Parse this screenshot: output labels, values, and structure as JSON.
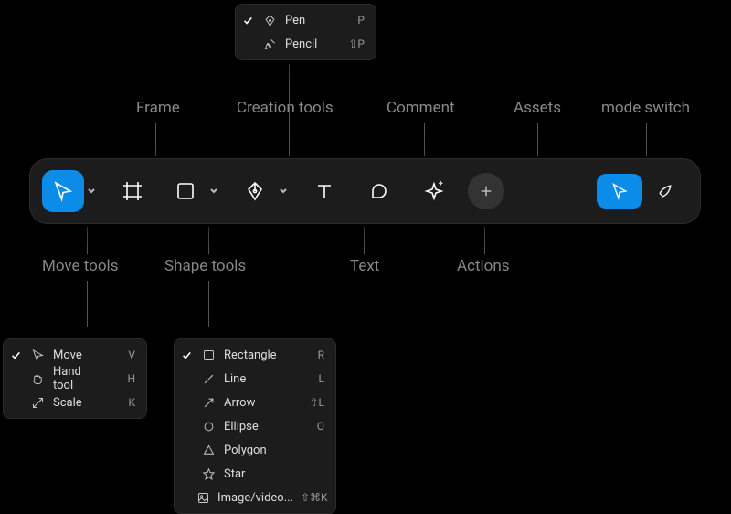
{
  "labels": {
    "frame": "Frame",
    "creation_tools": "Creation tools",
    "comment": "Comment",
    "assets": "Assets",
    "mode_switch": "mode switch",
    "move_tools": "Move tools",
    "shape_tools": "Shape tools",
    "text": "Text",
    "actions": "Actions"
  },
  "toolbar": {
    "move": {
      "name": "move-tool",
      "gap_after": 8,
      "has_chevron": true,
      "active": true
    },
    "frame": {
      "name": "frame-tool",
      "gap_after": 10
    },
    "shape": {
      "name": "shape-tool",
      "gap_after": 8,
      "has_chevron": true
    },
    "pen": {
      "name": "pen-tool",
      "gap_after": 8,
      "has_chevron": true
    },
    "text": {
      "name": "text-tool",
      "gap_after": 10
    },
    "comment": {
      "name": "comment-tool",
      "gap_after": 10
    },
    "actions": {
      "name": "actions-tool",
      "gap_after": 10
    },
    "add": {
      "name": "add-assets",
      "gap_after": 10
    }
  },
  "flyouts": {
    "pen": {
      "items": [
        {
          "checked": true,
          "icon": "pen",
          "label": "Pen",
          "shortcut": "P"
        },
        {
          "checked": false,
          "icon": "pencil",
          "label": "Pencil",
          "shortcut": "⇧P"
        }
      ]
    },
    "move": {
      "items": [
        {
          "checked": true,
          "icon": "cursor",
          "label": "Move",
          "shortcut": "V"
        },
        {
          "checked": false,
          "icon": "hand",
          "label": "Hand tool",
          "shortcut": "H"
        },
        {
          "checked": false,
          "icon": "scale",
          "label": "Scale",
          "shortcut": "K"
        }
      ]
    },
    "shape": {
      "items": [
        {
          "checked": true,
          "icon": "rect",
          "label": "Rectangle",
          "shortcut": "R"
        },
        {
          "checked": false,
          "icon": "line",
          "label": "Line",
          "shortcut": "L"
        },
        {
          "checked": false,
          "icon": "arrow",
          "label": "Arrow",
          "shortcut": "⇧L"
        },
        {
          "checked": false,
          "icon": "ellipse",
          "label": "Ellipse",
          "shortcut": "O"
        },
        {
          "checked": false,
          "icon": "polygon",
          "label": "Polygon",
          "shortcut": ""
        },
        {
          "checked": false,
          "icon": "star",
          "label": "Star",
          "shortcut": ""
        },
        {
          "checked": false,
          "icon": "image",
          "label": "Image/video...",
          "shortcut": "⇧⌘K"
        }
      ]
    }
  }
}
